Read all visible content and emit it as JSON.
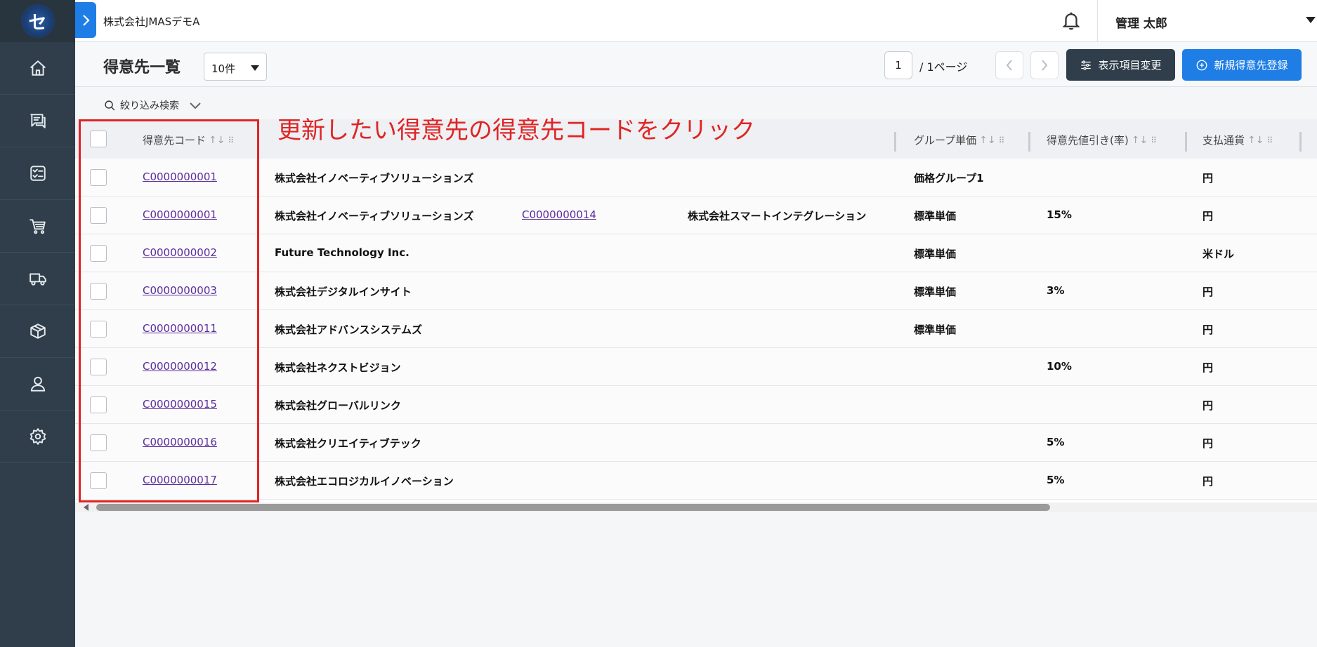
{
  "header": {
    "company": "株式会社JMASデモA",
    "user_name": "管理 太郎"
  },
  "page": {
    "title": "得意先一覧",
    "per_page": "10件",
    "current_page": "1",
    "total_pages": "/ 1ページ",
    "column_settings_label": "表示項目変更",
    "new_customer_label": "新規得意先登録",
    "filter_label": "絞り込み検索"
  },
  "annotation": {
    "text": "更新したい得意先の得意先コードをクリック",
    "color": "#e02424"
  },
  "table": {
    "headers": {
      "code": "得意先コード",
      "group_price": "グループ単価",
      "discount": "得意先値引き(率)",
      "currency": "支払通貨"
    },
    "rows": [
      {
        "code": "C0000000001",
        "name": "株式会社イノベーティブソリューションズ",
        "parent_code": "",
        "parent_name": "",
        "group_price": "価格グループ1",
        "discount": "",
        "currency": "円"
      },
      {
        "code": "C0000000001",
        "name": "株式会社イノベーティブソリューションズ",
        "parent_code": "C0000000014",
        "parent_name": "株式会社スマートインテグレーション",
        "group_price": "標準単価",
        "discount": "15%",
        "currency": "円"
      },
      {
        "code": "C0000000002",
        "name": "Future Technology Inc.",
        "parent_code": "",
        "parent_name": "",
        "group_price": "標準単価",
        "discount": "",
        "currency": "米ドル"
      },
      {
        "code": "C0000000003",
        "name": "株式会社デジタルインサイト",
        "parent_code": "",
        "parent_name": "",
        "group_price": "標準単価",
        "discount": "3%",
        "currency": "円"
      },
      {
        "code": "C0000000011",
        "name": "株式会社アドバンスシステムズ",
        "parent_code": "",
        "parent_name": "",
        "group_price": "標準単価",
        "discount": "",
        "currency": "円"
      },
      {
        "code": "C0000000012",
        "name": "株式会社ネクストビジョン",
        "parent_code": "",
        "parent_name": "",
        "group_price": "",
        "discount": "10%",
        "currency": "円"
      },
      {
        "code": "C0000000015",
        "name": "株式会社グローバルリンク",
        "parent_code": "",
        "parent_name": "",
        "group_price": "",
        "discount": "",
        "currency": "円"
      },
      {
        "code": "C0000000016",
        "name": "株式会社クリエイティブテック",
        "parent_code": "",
        "parent_name": "",
        "group_price": "",
        "discount": "5%",
        "currency": "円"
      },
      {
        "code": "C0000000017",
        "name": "株式会社エコロジカルイノベーション",
        "parent_code": "",
        "parent_name": "",
        "group_price": "",
        "discount": "5%",
        "currency": "円"
      }
    ]
  },
  "icons": {
    "sidebar": [
      "home-icon",
      "chat-icon",
      "checklist-icon",
      "cart-icon",
      "truck-icon",
      "package-icon",
      "user-icon",
      "gear-icon"
    ]
  }
}
